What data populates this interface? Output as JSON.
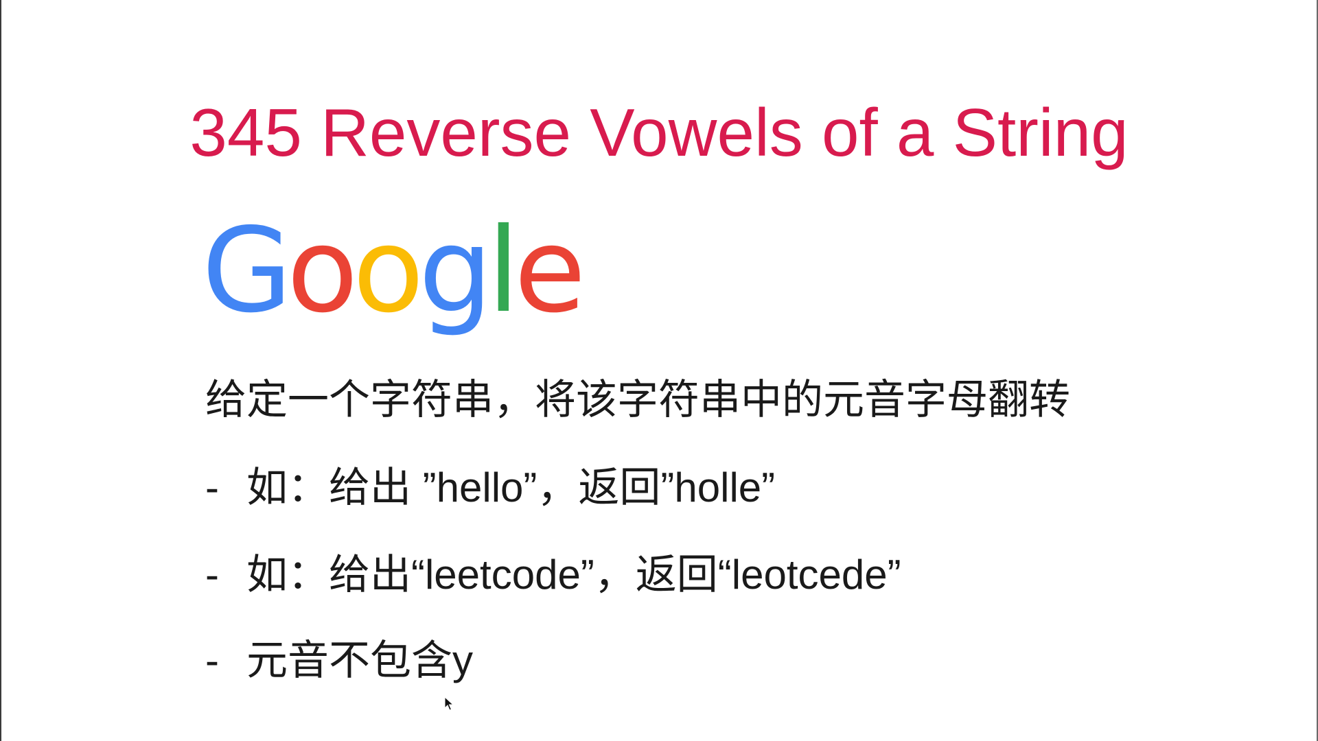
{
  "slide": {
    "title": "345 Reverse Vowels of a String",
    "logo": {
      "letters": [
        {
          "char": "G",
          "color": "#4285F4"
        },
        {
          "char": "o",
          "color": "#EA4335"
        },
        {
          "char": "o",
          "color": "#FBBC05"
        },
        {
          "char": "g",
          "color": "#4285F4"
        },
        {
          "char": "l",
          "color": "#34A853"
        },
        {
          "char": "e",
          "color": "#EA4335"
        }
      ]
    },
    "description": "给定一个字符串，将该字符串中的元音字母翻转",
    "items": [
      {
        "bullet": "-",
        "text": "如：给出 ”hello”，返回”holle”"
      },
      {
        "bullet": "-",
        "text": "如：给出“leetcode”，返回“leotcede”"
      },
      {
        "bullet": "-",
        "text": "元音不包含y"
      }
    ]
  },
  "colors": {
    "title": "#d81b4e",
    "text": "#1a1a1a"
  }
}
